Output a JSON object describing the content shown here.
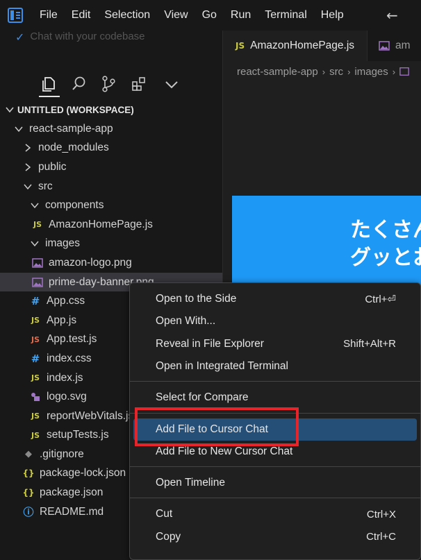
{
  "menu": [
    "File",
    "Edit",
    "Selection",
    "View",
    "Go",
    "Run",
    "Terminal",
    "Help"
  ],
  "sidebar": {
    "chat_hint": "Chat with your codebase",
    "workspace_title": "UNTITLED (WORKSPACE)",
    "tree": [
      {
        "label": "react-sample-app",
        "depth": 1,
        "type": "folder-open",
        "icon": ""
      },
      {
        "label": "node_modules",
        "depth": 2,
        "type": "folder-closed",
        "icon": ""
      },
      {
        "label": "public",
        "depth": 2,
        "type": "folder-closed",
        "icon": ""
      },
      {
        "label": "src",
        "depth": 2,
        "type": "folder-open",
        "icon": ""
      },
      {
        "label": "components",
        "depth": 3,
        "type": "folder-open",
        "icon": ""
      },
      {
        "label": "AmazonHomePage.js",
        "depth": 4,
        "type": "file",
        "icon": "js"
      },
      {
        "label": "images",
        "depth": 3,
        "type": "folder-open",
        "icon": ""
      },
      {
        "label": "amazon-logo.png",
        "depth": 4,
        "type": "file",
        "icon": "image"
      },
      {
        "label": "prime-day-banner.png",
        "depth": 4,
        "type": "file",
        "icon": "image",
        "selected": true
      },
      {
        "label": "App.css",
        "depth": 3,
        "type": "file",
        "icon": "css"
      },
      {
        "label": "App.js",
        "depth": 3,
        "type": "file",
        "icon": "js"
      },
      {
        "label": "App.test.js",
        "depth": 3,
        "type": "file",
        "icon": "jsred"
      },
      {
        "label": "index.css",
        "depth": 3,
        "type": "file",
        "icon": "css"
      },
      {
        "label": "index.js",
        "depth": 3,
        "type": "file",
        "icon": "js"
      },
      {
        "label": "logo.svg",
        "depth": 3,
        "type": "file",
        "icon": "svg"
      },
      {
        "label": "reportWebVitals.js",
        "depth": 3,
        "type": "file",
        "icon": "js"
      },
      {
        "label": "setupTests.js",
        "depth": 3,
        "type": "file",
        "icon": "js"
      },
      {
        "label": ".gitignore",
        "depth": 2,
        "type": "file",
        "icon": "git"
      },
      {
        "label": "package-lock.json",
        "depth": 2,
        "type": "file",
        "icon": "json"
      },
      {
        "label": "package.json",
        "depth": 2,
        "type": "file",
        "icon": "json"
      },
      {
        "label": "README.md",
        "depth": 2,
        "type": "file",
        "icon": "info"
      }
    ]
  },
  "editor": {
    "tabs": [
      {
        "label": "AmazonHomePage.js",
        "icon": "js"
      },
      {
        "label": "am",
        "icon": "image"
      }
    ],
    "breadcrumb": [
      "react-sample-app",
      "src",
      "images"
    ],
    "banner_lines": [
      "たくさん",
      "グッとお"
    ],
    "banner_color": "#1e98f5"
  },
  "context_menu": {
    "groups": [
      [
        {
          "label": "Open to the Side",
          "key": "Ctrl+⏎"
        },
        {
          "label": "Open With...",
          "key": ""
        },
        {
          "label": "Reveal in File Explorer",
          "key": "Shift+Alt+R"
        },
        {
          "label": "Open in Integrated Terminal",
          "key": ""
        }
      ],
      [
        {
          "label": "Select for Compare",
          "key": ""
        }
      ],
      [
        {
          "label": "Add File to Cursor Chat",
          "key": "",
          "active": true
        },
        {
          "label": "Add File to New Cursor Chat",
          "key": ""
        }
      ],
      [
        {
          "label": "Open Timeline",
          "key": ""
        }
      ],
      [
        {
          "label": "Cut",
          "key": "Ctrl+X"
        },
        {
          "label": "Copy",
          "key": "Ctrl+C"
        }
      ]
    ]
  },
  "colors": {
    "accent": "#264f78",
    "highlight_box": "#e8242b",
    "js_icon": "#cbcb41",
    "css_icon": "#42a5f5"
  }
}
